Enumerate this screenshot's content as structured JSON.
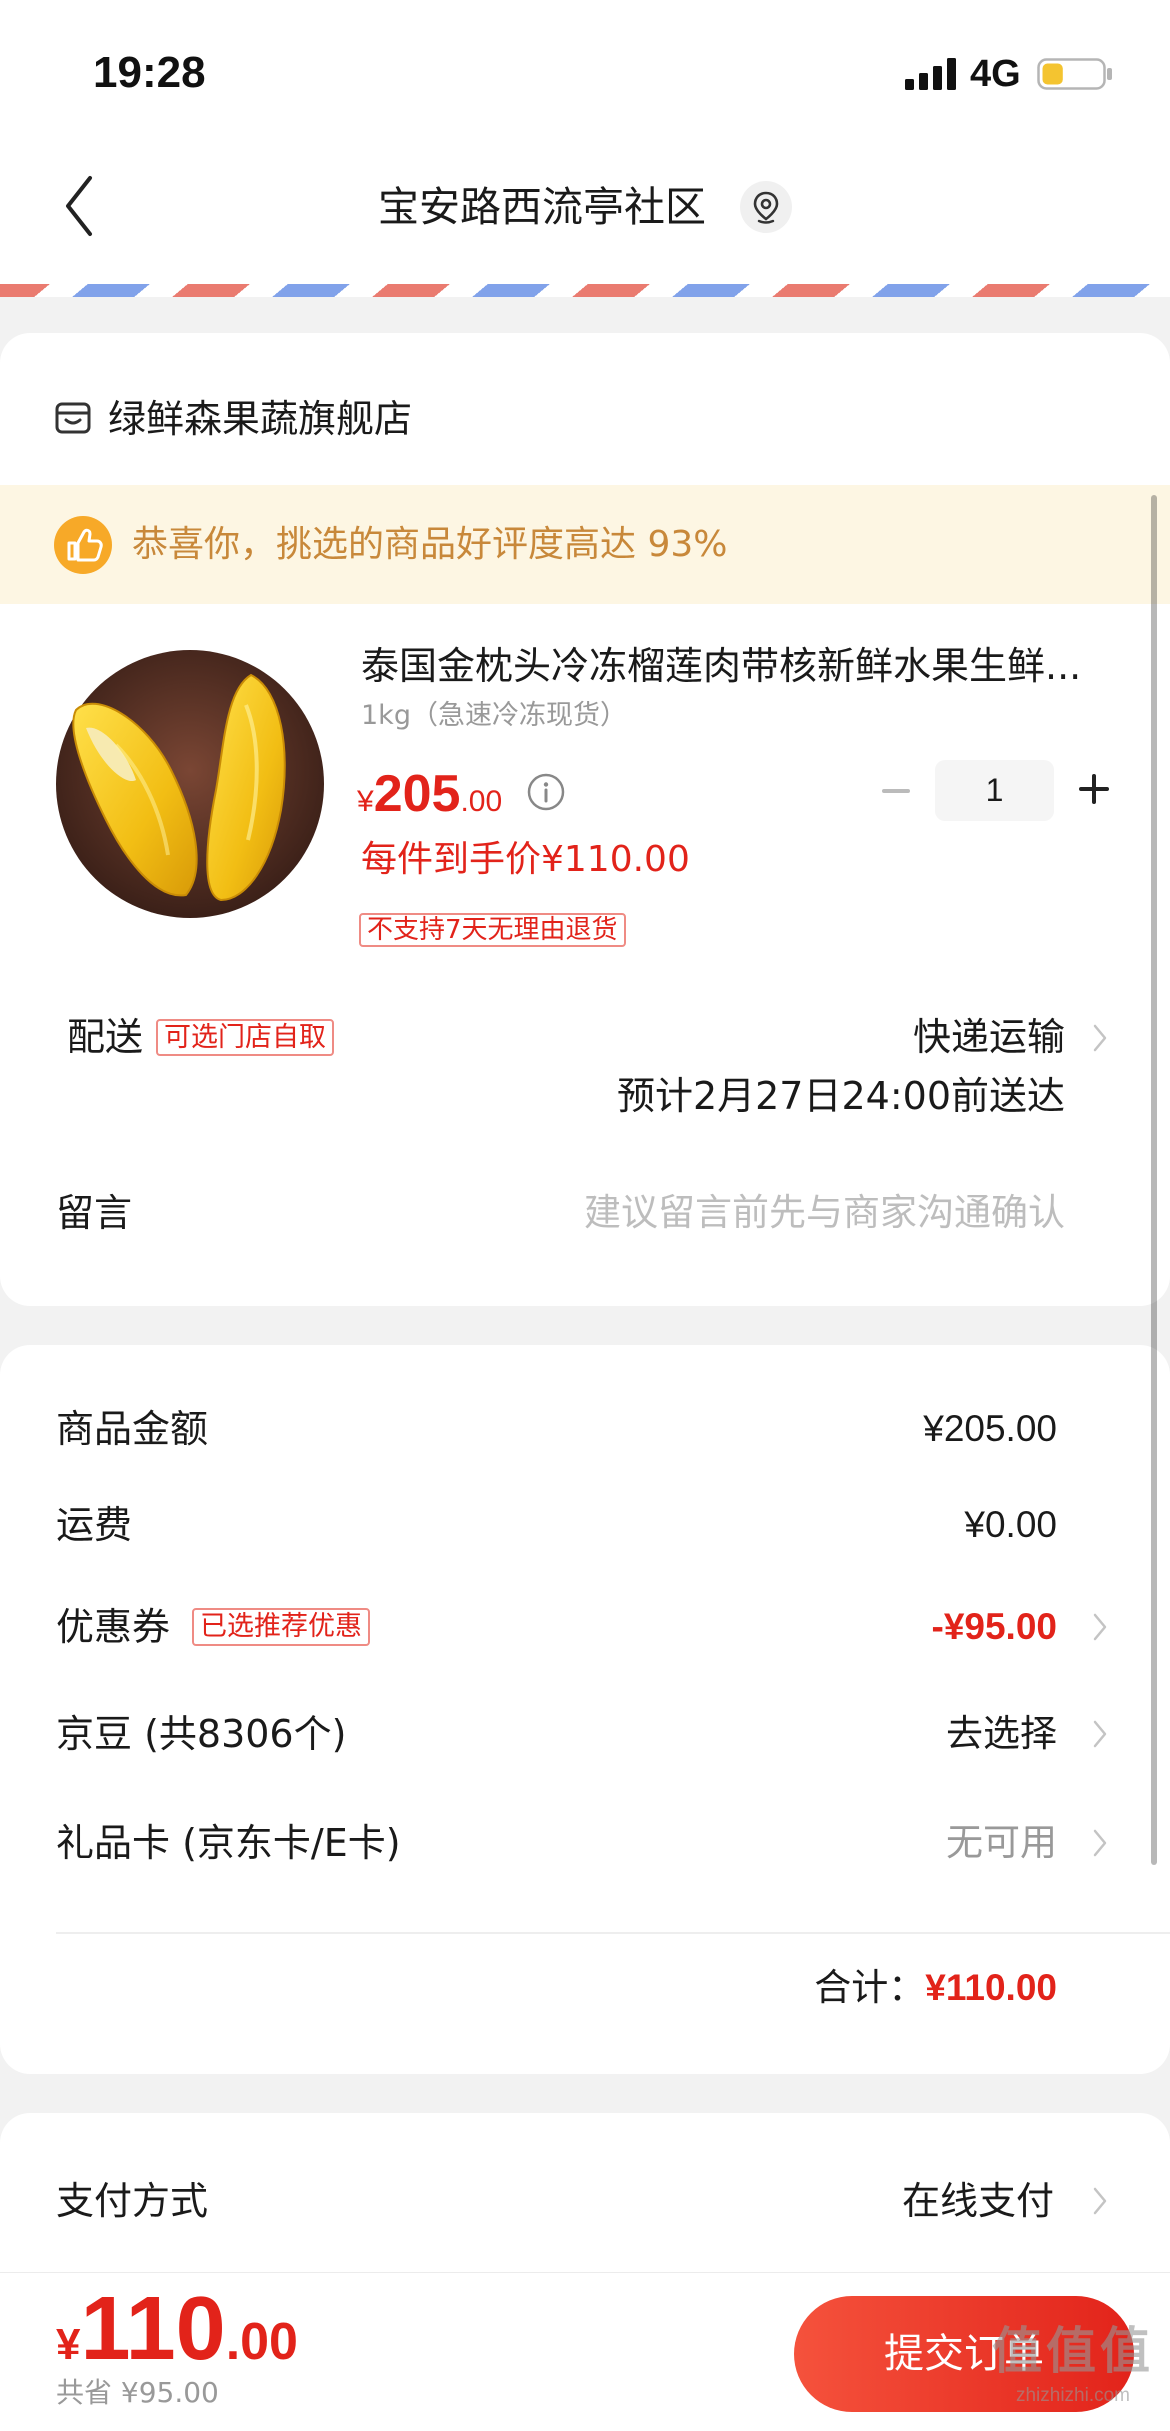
{
  "colors": {
    "accent_red": "#e2231a",
    "banner_background": "#fdf6e3",
    "banner_text": "#c8883a",
    "thumb_badge": "#f7a928",
    "stripe_red": "#ea7b70",
    "stripe_blue": "#81a2ea",
    "battery_fill": "#f4c430"
  },
  "status_bar": {
    "time": "19:28",
    "network": "4G",
    "battery_level": 0.35,
    "signal_icon": "signal-bars-icon",
    "battery_icon": "battery-icon"
  },
  "header": {
    "back_icon": "chevron-left-icon",
    "address": "宝安路西流亭社区",
    "location_icon": "location-pin-icon"
  },
  "store": {
    "icon": "store-icon",
    "name": "绿鲜森果蔬旗舰店"
  },
  "banner": {
    "icon": "thumbs-up-icon",
    "text": "恭喜你，挑选的商品好评度高达 93%"
  },
  "product": {
    "title": "泰国金枕头冷冻榴莲肉带核新鲜水果生鲜...",
    "spec": "1kg（急速冷冻现货）",
    "price": {
      "symbol": "¥",
      "integer": "205",
      "decimal": ".00"
    },
    "info_icon": "info-icon",
    "quantity": "1",
    "unit_price": "每件到手价¥110.00",
    "return_policy": "不支持7天无理由退货"
  },
  "delivery": {
    "label": "配送",
    "pickup_tag": "可选门店自取",
    "method": "快递运输",
    "eta": "预计2月27日24:00前送达"
  },
  "message": {
    "label": "留言",
    "placeholder": "建议留言前先与商家沟通确认"
  },
  "summary": {
    "rows": [
      {
        "label": "商品金额",
        "value": "¥205.00"
      },
      {
        "label": "运费",
        "value": "¥0.00"
      },
      {
        "label": "优惠券",
        "tag": "已选推荐优惠",
        "value": "-¥95.00"
      },
      {
        "label": "京豆 (共8306个)",
        "value": "去选择"
      },
      {
        "label": "礼品卡 (京东卡/E卡)",
        "value": "无可用"
      }
    ],
    "total_label": "合计：",
    "total_value": "¥110.00"
  },
  "payment": {
    "label": "支付方式",
    "value": "在线支付"
  },
  "footer": {
    "price": {
      "symbol": "¥",
      "integer": "110",
      "decimal": ".00"
    },
    "saved": "共省 ¥95.00",
    "submit": "提交订单"
  },
  "watermark": {
    "logo": "值值值",
    "site": "zhizhizhi.com"
  }
}
